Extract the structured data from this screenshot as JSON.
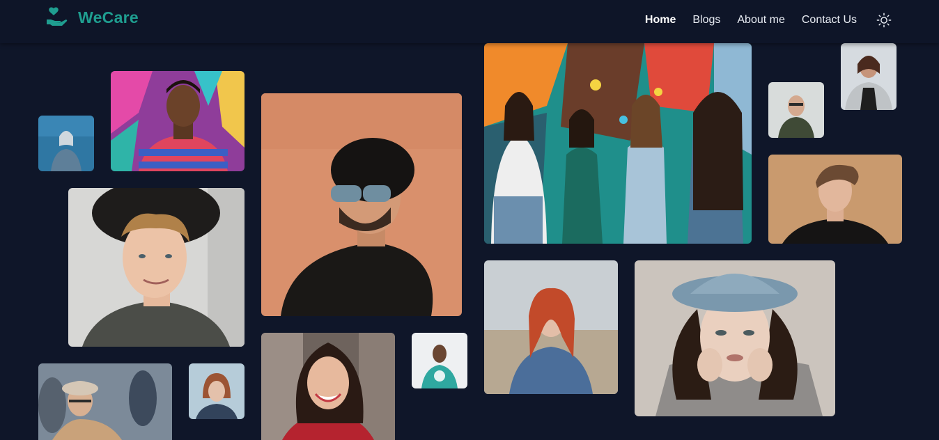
{
  "site": {
    "brand": "WeCare",
    "scroll_progress": 0.354
  },
  "nav": {
    "items": [
      {
        "label": "Home",
        "active": true
      },
      {
        "label": "Blogs",
        "active": false
      },
      {
        "label": "About me",
        "active": false
      },
      {
        "label": "Contact Us",
        "active": false
      }
    ],
    "theme_icon": "sun-icon"
  },
  "colors": {
    "background": "#0f1629",
    "header": "#0e1528",
    "accent": "#1f9e90",
    "progress": "#16a394"
  },
  "gallery": [
    {
      "subject": "woman-blue-wall"
    },
    {
      "subject": "man-graffiti-striped-shirt"
    },
    {
      "subject": "curly-man-black-hat"
    },
    {
      "subject": "man-hat-sunglasses"
    },
    {
      "subject": "four-women-mural"
    },
    {
      "subject": "bald-man-glasses"
    },
    {
      "subject": "woman-grey-cardigan"
    },
    {
      "subject": "young-man-tan-wall"
    },
    {
      "subject": "redhead-woman-field"
    },
    {
      "subject": "woman-blue-hat"
    },
    {
      "subject": "man-plaid-hat-crowd"
    },
    {
      "subject": "redhead-bob-woman"
    },
    {
      "subject": "smiling-woman-red-top"
    },
    {
      "subject": "man-tie-dye-shirt"
    }
  ]
}
